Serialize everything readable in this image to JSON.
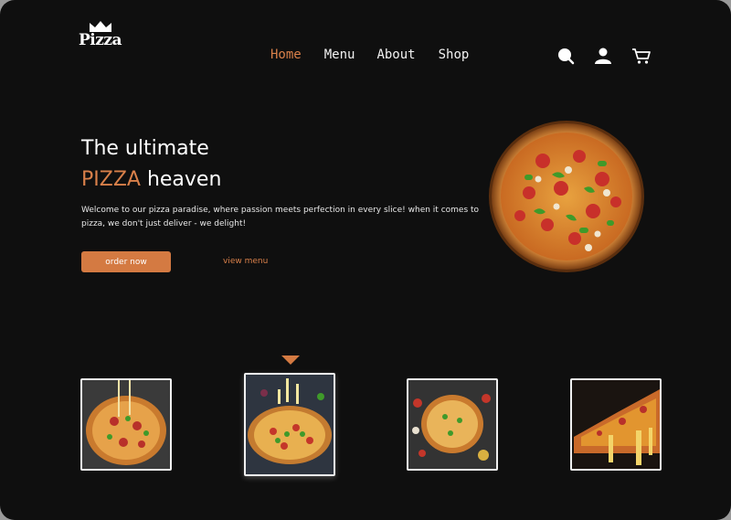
{
  "brand": {
    "logo_text": "Pizza"
  },
  "nav": {
    "items": [
      {
        "label": "Home",
        "active": true
      },
      {
        "label": "Menu",
        "active": false
      },
      {
        "label": "About",
        "active": false
      },
      {
        "label": "Shop",
        "active": false
      }
    ]
  },
  "header_icons": [
    "search-icon",
    "user-icon",
    "cart-icon"
  ],
  "hero": {
    "title_line1": "The ultimate",
    "title_accent": "PIZZA",
    "title_rest": " heaven",
    "description": "Welcome to our pizza paradise, where passion meets perfection in every slice! when it comes to pizza, we don't just deliver - we delight!",
    "order_label": "order now",
    "menu_label": "view menu"
  },
  "gallery": {
    "selected_index": 1,
    "count": 4
  },
  "colors": {
    "accent": "#d47a42",
    "background": "#0f0f0f",
    "text": "#ffffff"
  }
}
